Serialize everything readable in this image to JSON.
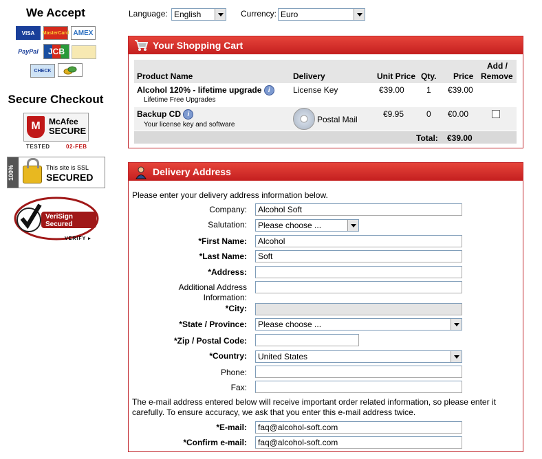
{
  "payment": {
    "title": "We Accept",
    "cards": [
      "VISA",
      "MasterCard",
      "AMEX",
      "PayPal",
      "JCB",
      "",
      "CHECK",
      ""
    ]
  },
  "secure": {
    "title": "Secure Checkout",
    "mcafee_label": "McAfee",
    "mcafee_label2": "SECURE",
    "mcafee_tested": "TESTED",
    "mcafee_date": "02-FEB",
    "ssl_percent": "100%",
    "ssl_small": "This site is SSL",
    "ssl_big": "SECURED",
    "verisign_line1": "VeriSign",
    "verisign_line2": "Secured",
    "verisign_verify": "VERIFY ▸"
  },
  "topbar": {
    "language_label": "Language:",
    "language_value": "English",
    "currency_label": "Currency:",
    "currency_value": "Euro"
  },
  "cart": {
    "title": "Your Shopping Cart",
    "headers": {
      "product": "Product Name",
      "delivery": "Delivery",
      "unit_price": "Unit Price",
      "qty": "Qty.",
      "price": "Price",
      "add_remove_1": "Add /",
      "add_remove_2": "Remove"
    },
    "items": [
      {
        "name": "Alcohol 120% - lifetime upgrade",
        "sub": "Lifetime Free Upgrades",
        "delivery": "License Key",
        "unit_price": "€39.00",
        "qty": "1",
        "price": "€39.00"
      },
      {
        "name": "Backup CD",
        "sub": "Your license key and software",
        "delivery": "Postal Mail",
        "unit_price": "€9.95",
        "qty": "0",
        "price": "€0.00"
      }
    ],
    "total_label": "Total:",
    "total_value": "€39.00"
  },
  "delivery": {
    "title": "Delivery Address",
    "intro": "Please enter your delivery address information below.",
    "company_label": "Company:",
    "company_value": "Alcohol Soft",
    "salutation_label": "Salutation:",
    "salutation_value": "Please choose ...",
    "first_name_label": "*First Name:",
    "first_name_value": "Alcohol",
    "last_name_label": "*Last Name:",
    "last_name_value": "Soft",
    "address_label": "*Address:",
    "address_value": "",
    "additional_label_1": "Additional Address",
    "additional_label_2": "Information:",
    "additional_value": "",
    "city_label": "*City:",
    "city_value": "",
    "state_label": "*State / Province:",
    "state_value": "Please choose ...",
    "zip_label": "*Zip / Postal Code:",
    "zip_value": "",
    "country_label": "*Country:",
    "country_value": "United States",
    "phone_label": "Phone:",
    "phone_value": "",
    "fax_label": "Fax:",
    "fax_value": "",
    "email_note": "The e-mail address entered below will receive important order related information, so please enter it carefully. To ensure accuracy, we ask that you enter this e-mail address twice.",
    "email_label": "*E-mail:",
    "email_value": "faq@alcohol-soft.com",
    "confirm_email_label": "*Confirm e-mail:",
    "confirm_email_value": "faq@alcohol-soft.com"
  }
}
